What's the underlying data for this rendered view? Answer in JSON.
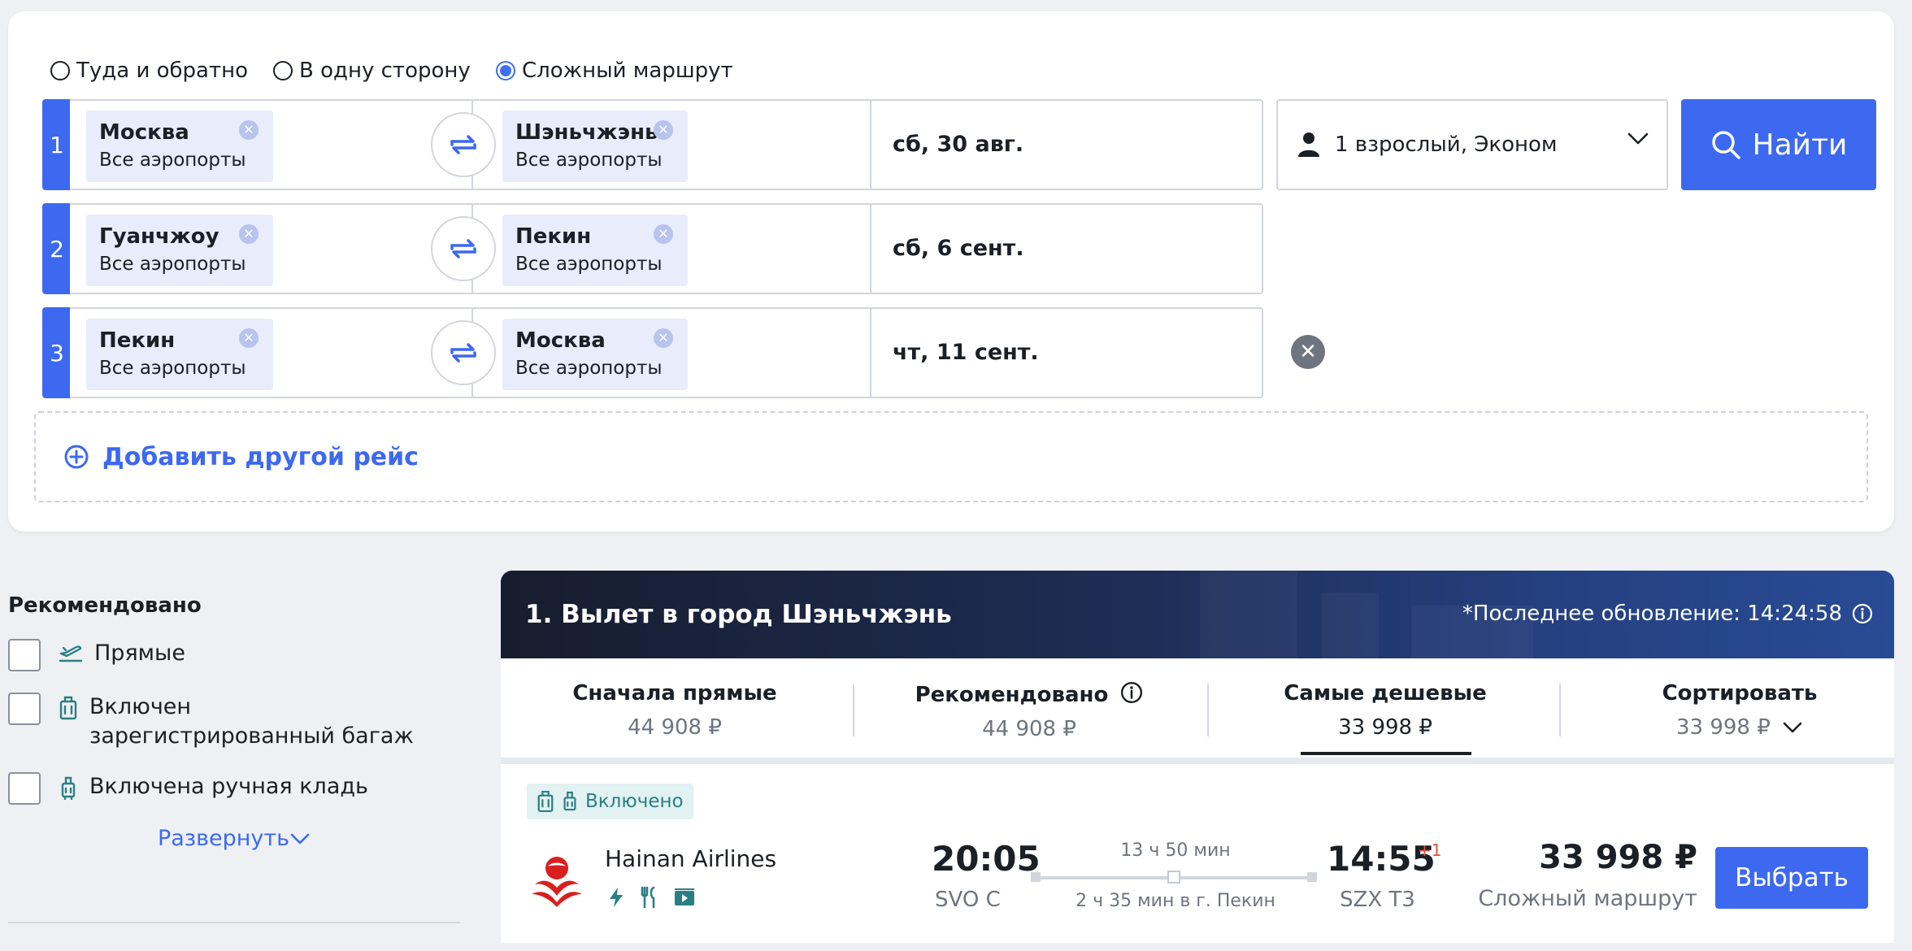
{
  "trip_types": [
    {
      "label": "Туда и обратно",
      "checked": false
    },
    {
      "label": "В одну сторону",
      "checked": false
    },
    {
      "label": "Сложный маршрут",
      "checked": true
    }
  ],
  "legs": [
    {
      "num": "1",
      "from_city": "Москва",
      "from_sub": "Все аэропорты",
      "to_city": "Шэньчжэнь",
      "to_sub": "Все аэропорты",
      "date": "сб, 30 авг."
    },
    {
      "num": "2",
      "from_city": "Гуанчжоу",
      "from_sub": "Все аэропорты",
      "to_city": "Пекин",
      "to_sub": "Все аэропорты",
      "date": "сб, 6 сент."
    },
    {
      "num": "3",
      "from_city": "Пекин",
      "from_sub": "Все аэропорты",
      "to_city": "Москва",
      "to_sub": "Все аэропорты",
      "date": "чт, 11 сент."
    }
  ],
  "passengers": "1 взрослый, Эконом",
  "search_label": "Найти",
  "add_flight_label": "Добавить другой рейс",
  "filters": {
    "title": "Рекомендовано",
    "items": [
      {
        "label": "Прямые",
        "icon": "plane-takeoff-icon"
      },
      {
        "label": "Включен зарегистрированный багаж",
        "icon": "checked-baggage-icon"
      },
      {
        "label": "Включена ручная кладь",
        "icon": "carry-on-icon"
      }
    ],
    "expand_label": "Развернуть"
  },
  "results": {
    "title": "1. Вылет в город Шэньчжэнь",
    "update": "*Последнее обновление: 14:24:58"
  },
  "sort_tabs": [
    {
      "title": "Сначала прямые",
      "price": "44 908 ₽"
    },
    {
      "title": "Рекомендовано",
      "price": "44 908 ₽"
    },
    {
      "title": "Самые дешевые",
      "price": "33 998 ₽",
      "active": true
    },
    {
      "title": "Сортировать",
      "price": "33 998 ₽"
    }
  ],
  "flight": {
    "baggage_badge": "Включено",
    "airline": "Hainan Airlines",
    "dep_time": "20:05",
    "dep_airport": "SVO C",
    "duration": "13 ч 50 мин",
    "layover": "2 ч 35 мин в г. Пекин",
    "arr_time": "14:55",
    "arr_plus": "+1",
    "arr_airport": "SZX T3",
    "price": "33 998 ₽",
    "price_sub": "Сложный маршрут",
    "choose_label": "Выбрать"
  },
  "colors": {
    "accent": "#3d69f0",
    "badge_text": "#2a7f84",
    "header_dark": "#171d2e"
  }
}
